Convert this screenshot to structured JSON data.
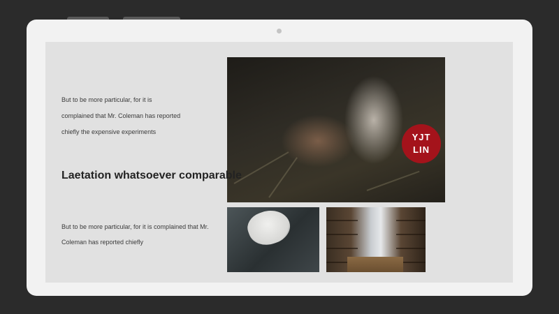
{
  "slide": {
    "paragraph_top": "But to be more particular, for it is complained that Mr. Coleman has reported chiefly the expensive experiments",
    "heading": "Laetation whatsoever comparable",
    "paragraph_bottom": "But to be more particular, for it is complained that Mr. Coleman has reported chiefly",
    "badge_line1": "YJT",
    "badge_line2": "LIN"
  },
  "colors": {
    "background": "#2b2b2b",
    "device": "#f2f2f2",
    "screen": "#e1e1e1",
    "badge": "#a4131b"
  }
}
